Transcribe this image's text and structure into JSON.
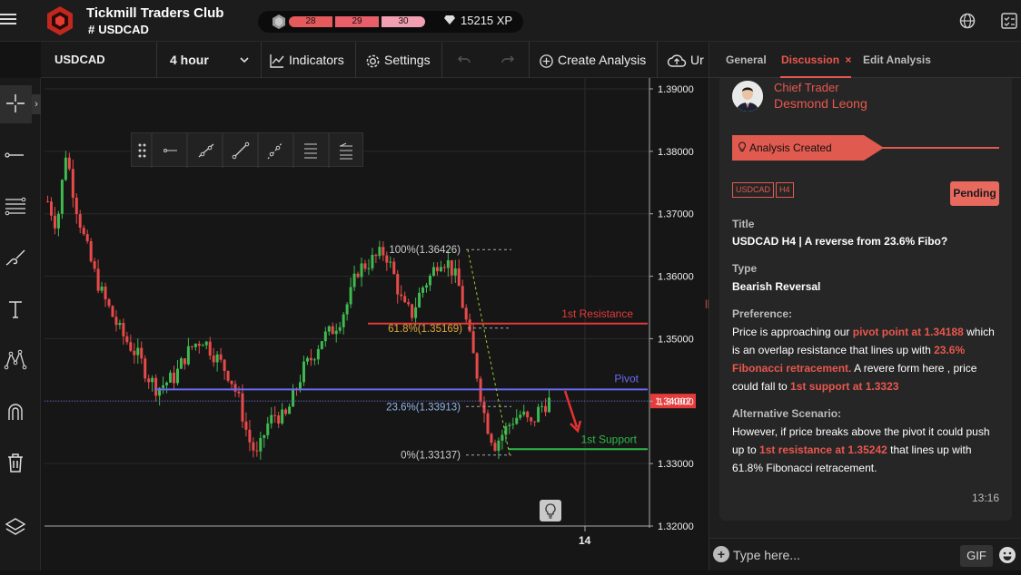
{
  "header": {
    "club_title": "Tickmill Traders Club",
    "symbol_hash": "#",
    "symbol": "USDCAD",
    "xp_levels": [
      "28",
      "29",
      "30"
    ],
    "xp_value": "15215 XP"
  },
  "toolbar": {
    "symbol": "USDCAD",
    "interval": "4 hour",
    "indicators_label": "Indicators",
    "settings_label": "Settings",
    "create_analysis_label": "Create Analysis",
    "upload_label": "Ur"
  },
  "chart_data": {
    "type": "candlestick",
    "symbol": "USDCAD",
    "timeframe": "4 hour",
    "ylim": [
      1.32,
      1.39
    ],
    "y_ticks": [
      "1.39000",
      "1.38000",
      "1.37000",
      "1.36000",
      "1.35000",
      "1.34000",
      "1.33000",
      "1.32000"
    ],
    "x_ticks": [
      "14"
    ],
    "last_price": "1.34002",
    "levels": [
      {
        "name": "1st Resistance",
        "value": 1.35242,
        "color": "#e23a3a"
      },
      {
        "name": "Pivot",
        "value": 1.34188,
        "color": "#6a6af0"
      },
      {
        "name": "1st Support",
        "value": 1.3323,
        "color": "#2fb84a"
      }
    ],
    "fibonacci": [
      {
        "label": "100%(1.36426)",
        "value": 1.36426
      },
      {
        "label": "61.8%(1.35169)",
        "value": 1.35169
      },
      {
        "label": "23.6%(1.33913)",
        "value": 1.33913
      },
      {
        "label": "0%(1.33137)",
        "value": 1.33137
      }
    ],
    "close_path": [
      1.372,
      1.368,
      1.38,
      1.372,
      1.366,
      1.361,
      1.357,
      1.354,
      1.351,
      1.349,
      1.347,
      1.344,
      1.342,
      1.343,
      1.344,
      1.347,
      1.349,
      1.35,
      1.348,
      1.346,
      1.344,
      1.34,
      1.334,
      1.331,
      1.336,
      1.338,
      1.337,
      1.341,
      1.345,
      1.347,
      1.35,
      1.351,
      1.353,
      1.356,
      1.361,
      1.362,
      1.363,
      1.364,
      1.36,
      1.355,
      1.354,
      1.358,
      1.36,
      1.363,
      1.362,
      1.359,
      1.352,
      1.345,
      1.337,
      1.333,
      1.335,
      1.337,
      1.338,
      1.336,
      1.339,
      1.34
    ]
  },
  "drawing_tools": {
    "colors": {
      "panel": "#222222"
    }
  },
  "left_tools": [
    "crosshair-icon",
    "line-icon",
    "fib-icon",
    "brush-icon",
    "text-icon",
    "pattern-icon",
    "magnet-icon",
    "trash-icon",
    "layers-icon"
  ],
  "panel": {
    "tabs": [
      {
        "label": "General"
      },
      {
        "label": "Discussion"
      },
      {
        "label": "Edit Analysis"
      }
    ],
    "close_glyph": "×",
    "role": "Chief Trader",
    "name": "Desmond Leong",
    "ribbon": "Analysis Created",
    "tags": [
      "USDCAD",
      "H4"
    ],
    "status": "Pending",
    "title_label": "Title",
    "title_value": "USDCAD H4 | A reverse from 23.6% Fibo?",
    "type_label": "Type",
    "type_value": "Bearish Reversal",
    "preference_label": "Preference:",
    "pref_1": "Price is approaching our ",
    "pref_2": "pivot point at 1.34188",
    "pref_3": " which is an overlap resistance that lines up with ",
    "pref_4": "23.6% Fibonacci retracement.",
    "pref_5": " A revere form here , price could fall to ",
    "pref_6": "1st support at 1.3323",
    "alt_label": "Alternative Scenario:",
    "alt_1": "However, if price breaks above the  pivot it could push up to ",
    "alt_2": "1st resistance at 1.35242",
    "alt_3": " that lines up with 61.8% Fibonacci retracement.",
    "time": "13:16",
    "composer_placeholder": "Type here...",
    "gif_label": "GIF"
  }
}
